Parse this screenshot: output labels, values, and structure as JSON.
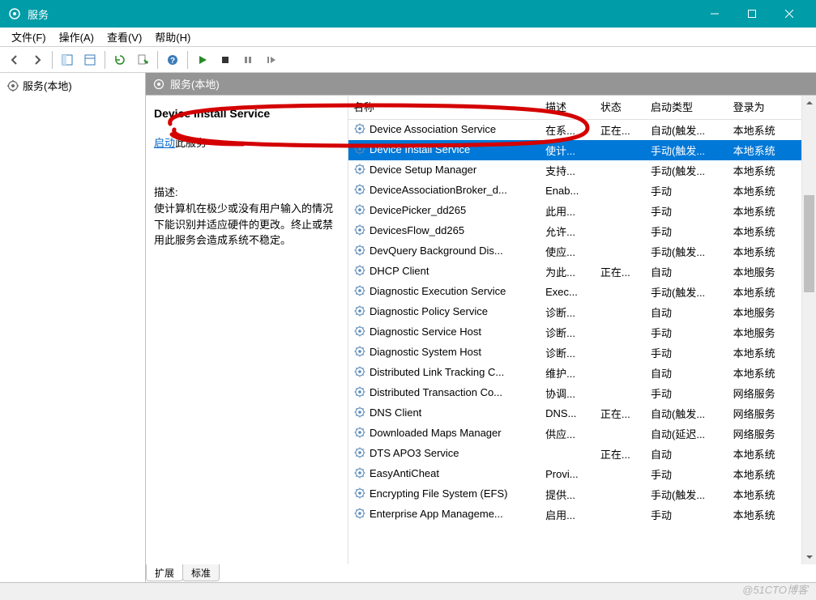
{
  "window": {
    "title": "服务"
  },
  "menu": {
    "file": "文件(F)",
    "action": "操作(A)",
    "view": "查看(V)",
    "help": "帮助(H)"
  },
  "tree": {
    "root": "服务(本地)"
  },
  "header": {
    "title": "服务(本地)"
  },
  "detail": {
    "title": "Device Install Service",
    "start_link": "启动",
    "start_suffix": "此服务",
    "desc_label": "描述:",
    "desc_text": "使计算机在极少或没有用户输入的情况下能识别并适应硬件的更改。终止或禁用此服务会造成系统不稳定。"
  },
  "columns": {
    "name": "名称",
    "desc": "描述",
    "status": "状态",
    "startup": "启动类型",
    "logon": "登录为"
  },
  "services": [
    {
      "name": "Device Association Service",
      "desc": "在系...",
      "status": "正在...",
      "startup": "自动(触发...",
      "logon": "本地系统",
      "selected": false
    },
    {
      "name": "Device Install Service",
      "desc": "使计...",
      "status": "",
      "startup": "手动(触发...",
      "logon": "本地系统",
      "selected": true
    },
    {
      "name": "Device Setup Manager",
      "desc": "支持...",
      "status": "",
      "startup": "手动(触发...",
      "logon": "本地系统",
      "selected": false
    },
    {
      "name": "DeviceAssociationBroker_d...",
      "desc": "Enab...",
      "status": "",
      "startup": "手动",
      "logon": "本地系统",
      "selected": false
    },
    {
      "name": "DevicePicker_dd265",
      "desc": "此用...",
      "status": "",
      "startup": "手动",
      "logon": "本地系统",
      "selected": false
    },
    {
      "name": "DevicesFlow_dd265",
      "desc": "允许...",
      "status": "",
      "startup": "手动",
      "logon": "本地系统",
      "selected": false
    },
    {
      "name": "DevQuery Background Dis...",
      "desc": "使应...",
      "status": "",
      "startup": "手动(触发...",
      "logon": "本地系统",
      "selected": false
    },
    {
      "name": "DHCP Client",
      "desc": "为此...",
      "status": "正在...",
      "startup": "自动",
      "logon": "本地服务",
      "selected": false
    },
    {
      "name": "Diagnostic Execution Service",
      "desc": "Exec...",
      "status": "",
      "startup": "手动(触发...",
      "logon": "本地系统",
      "selected": false
    },
    {
      "name": "Diagnostic Policy Service",
      "desc": "诊断...",
      "status": "",
      "startup": "自动",
      "logon": "本地服务",
      "selected": false
    },
    {
      "name": "Diagnostic Service Host",
      "desc": "诊断...",
      "status": "",
      "startup": "手动",
      "logon": "本地服务",
      "selected": false
    },
    {
      "name": "Diagnostic System Host",
      "desc": "诊断...",
      "status": "",
      "startup": "手动",
      "logon": "本地系统",
      "selected": false
    },
    {
      "name": "Distributed Link Tracking C...",
      "desc": "维护...",
      "status": "",
      "startup": "自动",
      "logon": "本地系统",
      "selected": false
    },
    {
      "name": "Distributed Transaction Co...",
      "desc": "协调...",
      "status": "",
      "startup": "手动",
      "logon": "网络服务",
      "selected": false
    },
    {
      "name": "DNS Client",
      "desc": "DNS...",
      "status": "正在...",
      "startup": "自动(触发...",
      "logon": "网络服务",
      "selected": false
    },
    {
      "name": "Downloaded Maps Manager",
      "desc": "供应...",
      "status": "",
      "startup": "自动(延迟...",
      "logon": "网络服务",
      "selected": false
    },
    {
      "name": "DTS APO3 Service",
      "desc": "",
      "status": "正在...",
      "startup": "自动",
      "logon": "本地系统",
      "selected": false
    },
    {
      "name": "EasyAntiCheat",
      "desc": "Provi...",
      "status": "",
      "startup": "手动",
      "logon": "本地系统",
      "selected": false
    },
    {
      "name": "Encrypting File System (EFS)",
      "desc": "提供...",
      "status": "",
      "startup": "手动(触发...",
      "logon": "本地系统",
      "selected": false
    },
    {
      "name": "Enterprise App Manageme...",
      "desc": "启用...",
      "status": "",
      "startup": "手动",
      "logon": "本地系统",
      "selected": false
    }
  ],
  "tabs": {
    "extended": "扩展",
    "standard": "标准"
  },
  "watermark": "@51CTO博客"
}
